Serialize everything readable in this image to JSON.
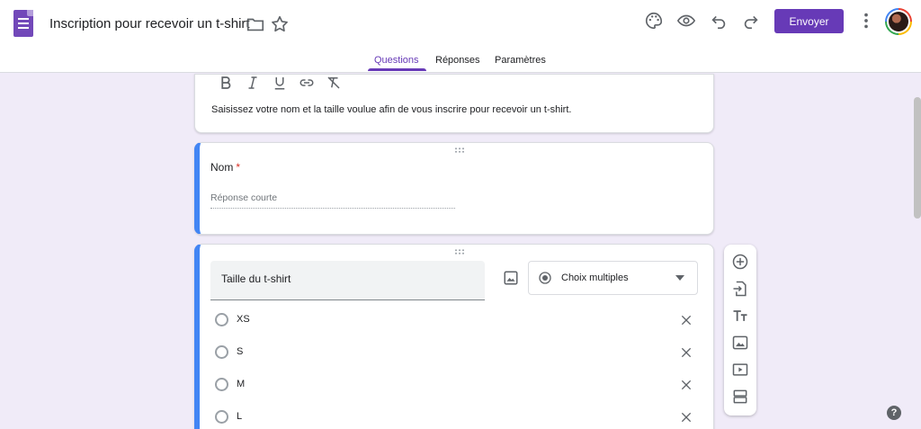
{
  "app": {
    "title": "Inscription pour recevoir un t-shirt",
    "send_label": "Envoyer",
    "accent": "#673ab7"
  },
  "tabs": [
    {
      "label": "Questions",
      "active": true
    },
    {
      "label": "Réponses",
      "active": false
    },
    {
      "label": "Paramètres",
      "active": false
    }
  ],
  "description_card": {
    "text": "Saisissez votre nom et la taille voulue afin de vous inscrire pour recevoir un t-shirt.",
    "format_icons": [
      "bold-icon",
      "italic-icon",
      "underline-icon",
      "link-icon",
      "clear-format-icon"
    ]
  },
  "question_nom": {
    "title": "Nom",
    "required_mark": "*",
    "placeholder": "Réponse courte"
  },
  "question_taille": {
    "title": "Taille du t-shirt",
    "type": "Choix multiples",
    "options": [
      "XS",
      "S",
      "M",
      "L"
    ]
  },
  "toolbar_icons": [
    "add-question-icon",
    "import-questions-icon",
    "add-title-icon",
    "add-image-icon",
    "add-video-icon",
    "add-section-icon"
  ],
  "help_label": "?"
}
